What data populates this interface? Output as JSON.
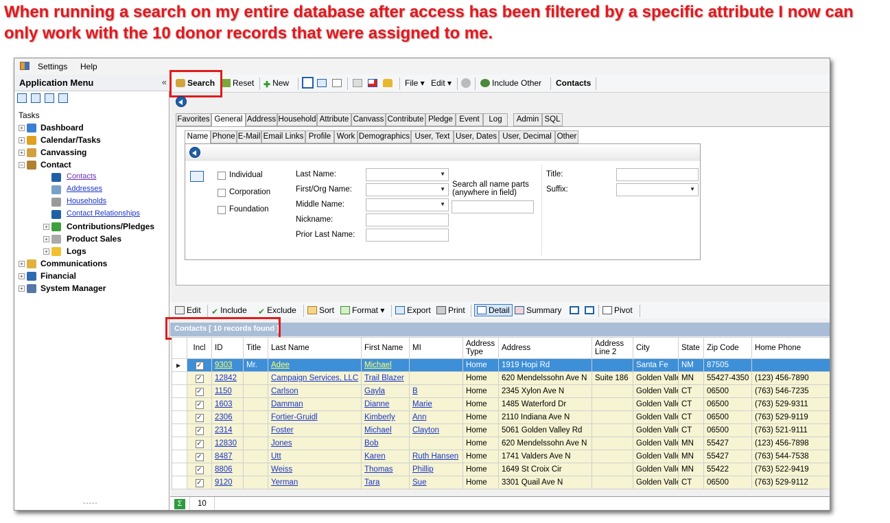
{
  "caption": "When running a search on my entire database after access has been filtered by a specific attribute I now can only work with the 10 donor records that were assigned to me.",
  "menu": {
    "settings": "Settings",
    "help": "Help"
  },
  "leftpane": {
    "title": "Application Menu",
    "collapse": "«",
    "tasks_label": "Tasks",
    "tree": [
      {
        "label": "Dashboard",
        "kind": "top"
      },
      {
        "label": "Calendar/Tasks",
        "kind": "top"
      },
      {
        "label": "Canvassing",
        "kind": "top"
      },
      {
        "label": "Contact",
        "kind": "top"
      },
      {
        "label": "Contacts",
        "kind": "link"
      },
      {
        "label": "Addresses",
        "kind": "link"
      },
      {
        "label": "Households",
        "kind": "link"
      },
      {
        "label": "Contact Relationships",
        "kind": "link"
      },
      {
        "label": "Contributions/Pledges",
        "kind": "sub"
      },
      {
        "label": "Product Sales",
        "kind": "sub"
      },
      {
        "label": "Logs",
        "kind": "sub"
      },
      {
        "label": "Communications",
        "kind": "top"
      },
      {
        "label": "Financial",
        "kind": "top"
      },
      {
        "label": "System Manager",
        "kind": "top"
      }
    ],
    "footer": "-----"
  },
  "toolbar": {
    "search": "Search",
    "reset": "Reset",
    "new": "New",
    "file": "File",
    "edit": "Edit",
    "include_other": "Include Other",
    "contacts": "Contacts"
  },
  "tabs": [
    "Favorites",
    "General",
    "Address",
    "Household",
    "Attribute",
    "Canvass",
    "Contribute",
    "Pledge",
    "Event",
    "Log",
    "Admin",
    "SQL"
  ],
  "subtabs": [
    "Name",
    "Phone",
    "E-Mail",
    "Email Links",
    "Profile",
    "Work",
    "Demographics",
    "User, Text",
    "User, Dates",
    "User, Decimal",
    "Other"
  ],
  "form": {
    "checkboxes": [
      "Individual",
      "Corporation",
      "Foundation"
    ],
    "last_name": "Last Name:",
    "first_org_name": "First/Org Name:",
    "middle_name": "Middle Name:",
    "nickname": "Nickname:",
    "prior_last_name": "Prior Last Name:",
    "search_all_1": "Search all name parts",
    "search_all_2": "(anywhere in field)",
    "title": "Title:",
    "suffix": "Suffix:"
  },
  "grid_toolbar": {
    "edit": "Edit",
    "include": "Include",
    "exclude": "Exclude",
    "sort": "Sort",
    "format": "Format",
    "export": "Export",
    "print": "Print",
    "detail": "Detail",
    "summary": "Summary",
    "pivot": "Pivot"
  },
  "grid_header": "Contacts [ 10 records found ]",
  "columns": [
    "Incl",
    "ID",
    "Title",
    "Last Name",
    "First Name",
    "MI",
    "Address Type",
    "Address",
    "Address Line 2",
    "City",
    "State",
    "Zip Code",
    "Home Phone"
  ],
  "rows": [
    {
      "id": "9303",
      "title": "Mr.",
      "last": "Adee",
      "first": "Michael",
      "mi": "",
      "atype": "Home",
      "address": "1919 Hopi Rd",
      "line2": "",
      "city": "Santa Fe",
      "state": "NM",
      "zip": "87505",
      "phone": ""
    },
    {
      "id": "12842",
      "title": "",
      "last": "Campaign Services, LLC",
      "first": "Trail Blazer",
      "mi": "",
      "atype": "Home",
      "address": "620 Mendelssohn Ave N",
      "line2": "Suite 186",
      "city": "Golden Valley",
      "state": "MN",
      "zip": "55427-4350",
      "phone": "(123) 456-7890"
    },
    {
      "id": "1150",
      "title": "",
      "last": "Carlson",
      "first": "Gayla",
      "mi": "B",
      "atype": "Home",
      "address": "2345 Xylon Ave N",
      "line2": "",
      "city": "Golden Valley",
      "state": "CT",
      "zip": "06500",
      "phone": "(763) 546-7235"
    },
    {
      "id": "1603",
      "title": "",
      "last": "Damman",
      "first": "Dianne",
      "mi": "Marie",
      "atype": "Home",
      "address": "1485 Waterford Dr",
      "line2": "",
      "city": "Golden Valley",
      "state": "CT",
      "zip": "06500",
      "phone": "(763) 529-9311"
    },
    {
      "id": "2306",
      "title": "",
      "last": "Fortier-Gruidl",
      "first": "Kimberly",
      "mi": "Ann",
      "atype": "Home",
      "address": "2110 Indiana Ave N",
      "line2": "",
      "city": "Golden Valley",
      "state": "CT",
      "zip": "06500",
      "phone": "(763) 529-9119"
    },
    {
      "id": "2314",
      "title": "",
      "last": "Foster",
      "first": "Michael",
      "mi": "Clayton",
      "atype": "Home",
      "address": "5061 Golden Valley Rd",
      "line2": "",
      "city": "Golden Valley",
      "state": "CT",
      "zip": "06500",
      "phone": "(763) 521-9111"
    },
    {
      "id": "12830",
      "title": "",
      "last": "Jones",
      "first": "Bob",
      "mi": "",
      "atype": "Home",
      "address": "620 Mendelssohn Ave N",
      "line2": "",
      "city": "Golden Valley",
      "state": "MN",
      "zip": "55427",
      "phone": "(123) 456-7898"
    },
    {
      "id": "8487",
      "title": "",
      "last": "Utt",
      "first": "Karen",
      "mi": "Ruth Hansen",
      "atype": "Home",
      "address": "1741 Valders Ave N",
      "line2": "",
      "city": "Golden Valley",
      "state": "MN",
      "zip": "55427",
      "phone": "(763) 544-7538"
    },
    {
      "id": "8806",
      "title": "",
      "last": "Weiss",
      "first": "Thomas",
      "mi": "Phillip",
      "atype": "Home",
      "address": "1649 St Croix Cir",
      "line2": "",
      "city": "Golden Valley",
      "state": "MN",
      "zip": "55422",
      "phone": "(763) 522-9419"
    },
    {
      "id": "9120",
      "title": "",
      "last": "Yerman",
      "first": "Tara",
      "mi": "Sue",
      "atype": "Home",
      "address": "3301 Quail Ave N",
      "line2": "",
      "city": "Golden Valley",
      "state": "CT",
      "zip": "06500",
      "phone": "(763) 529-9112"
    }
  ],
  "footer_count": "10",
  "colors": {
    "caption": "#e8161b",
    "highlight_box": "#e01b1b",
    "selected_row": "#3d8fd8",
    "row_bg": "#f6f4d2",
    "link": "#1a35c9"
  }
}
